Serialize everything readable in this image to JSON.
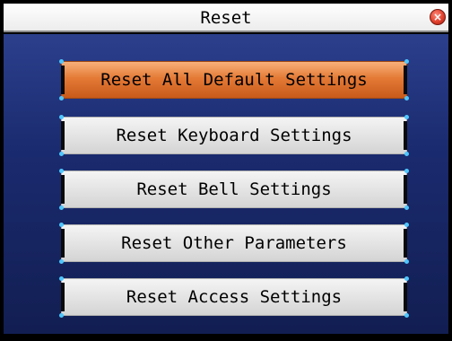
{
  "window": {
    "title": "Reset"
  },
  "colors": {
    "background": "#000000",
    "panel": "#1f2f78",
    "selected": "#e47a36",
    "button": "#e6e6e6",
    "corner_dot": "#4ec7ff",
    "close": "#e0402c"
  },
  "icons": {
    "close": "close-icon"
  },
  "menu": {
    "selected_index": 0,
    "items": [
      {
        "label": "Reset All Default Settings"
      },
      {
        "label": "Reset Keyboard Settings"
      },
      {
        "label": "Reset Bell Settings"
      },
      {
        "label": "Reset Other Parameters"
      },
      {
        "label": "Reset Access Settings"
      }
    ]
  }
}
